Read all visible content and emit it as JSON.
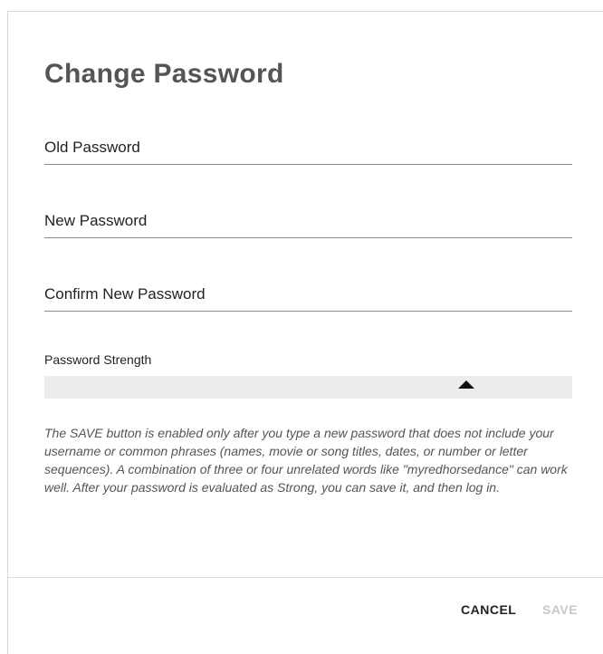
{
  "dialog": {
    "title": "Change Password"
  },
  "fields": {
    "old_password": {
      "placeholder": "Old Password",
      "value": ""
    },
    "new_password": {
      "placeholder": "New Password",
      "value": ""
    },
    "confirm_password": {
      "placeholder": "Confirm New Password",
      "value": ""
    }
  },
  "strength": {
    "label": "Password Strength",
    "level": 0
  },
  "help_text": "The SAVE button is enabled only after you type a new password that does not include your username or common phrases (names, movie or song titles, dates, or number or letter sequences). A combination of three or four unrelated words like \"myredhorsedance\" can work well. After your password is evaluated as Strong, you can save it, and then log in.",
  "buttons": {
    "cancel": "CANCEL",
    "save": "SAVE",
    "save_enabled": false
  },
  "icons": {
    "strength_marker": "caret-up-icon"
  },
  "colors": {
    "title": "#555555",
    "save_disabled": "#c8c8c8",
    "strength_bar": "#ededed"
  }
}
